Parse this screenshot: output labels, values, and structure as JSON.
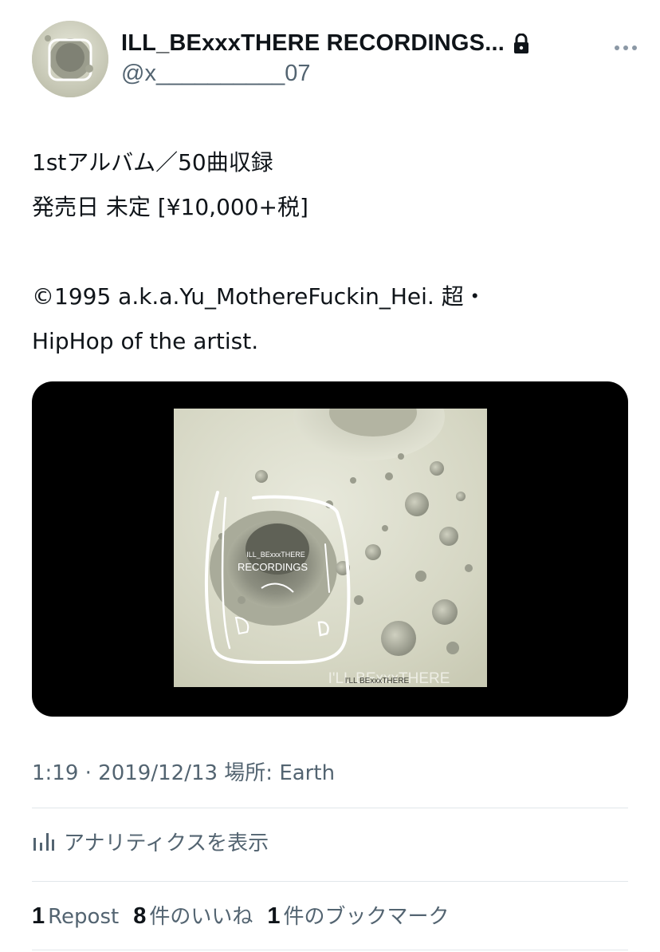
{
  "author": {
    "display_name": "ILL_BExxxTHERE RECORDINGS...",
    "handle": "@x__________07",
    "avatar_icon": "album-cover-avatar",
    "protected_icon": "lock-icon"
  },
  "tweet": {
    "lines": [
      "1stアルバム／50曲収録",
      "発売日 未定 [¥10,000+税]",
      "",
      "©1995 a.k.a.Yu_MothereFuckin_Hei. 超・",
      "HipHop of the artist."
    ]
  },
  "media": {
    "cover_title_small": "ILL_BExxxTHERE",
    "cover_title_large": "RECORDINGS",
    "cover_footer_ghost": "I'LL BExxxTHERE",
    "cover_footer": "I'LL BExxxTHERE"
  },
  "meta": {
    "timestamp": "1:19 · 2019/12/13 場所: Earth"
  },
  "analytics": {
    "label": "アナリティクスを表示",
    "icon": "bar-chart-icon"
  },
  "stats": [
    {
      "count": "1",
      "label": "Repost"
    },
    {
      "count": "8",
      "label": "件のいいね"
    },
    {
      "count": "1",
      "label": "件のブックマーク"
    }
  ],
  "colors": {
    "primary_text": "#0f1419",
    "secondary_text": "#536471",
    "divider": "#e1e6ea",
    "media_background": "#000000"
  }
}
